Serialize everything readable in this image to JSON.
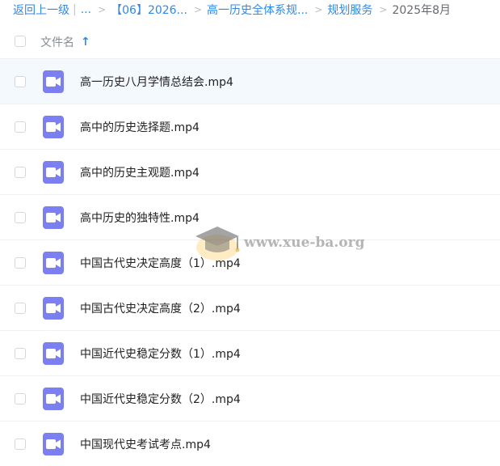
{
  "breadcrumb": {
    "back": "返回上一级",
    "ellipsis": "...",
    "items": [
      "【06】2026...",
      "高一历史全体系规...",
      "规划服务"
    ],
    "current": "2025年8月"
  },
  "header": {
    "column": "文件名",
    "sort_arrow": "↑"
  },
  "files": [
    "高一历史八月学情总结会.mp4",
    "高中的历史选择题.mp4",
    "高中的历史主观题.mp4",
    "高中历史的独特性.mp4",
    "中国古代史决定高度（1）.mp4",
    "中国古代史决定高度（2）.mp4",
    "中国近代史稳定分数（1）.mp4",
    "中国近代史稳定分数（2）.mp4",
    "中国现代史考试考点.mp4"
  ],
  "watermark": {
    "text": "www.xue-ba.org"
  },
  "colors": {
    "link": "#2f8ae6",
    "video_icon": "#7b7ff0",
    "hover_row": "#f4f9fe"
  },
  "icons": {
    "file": "video-file-icon",
    "watermark": "graduation-cap-icon"
  }
}
